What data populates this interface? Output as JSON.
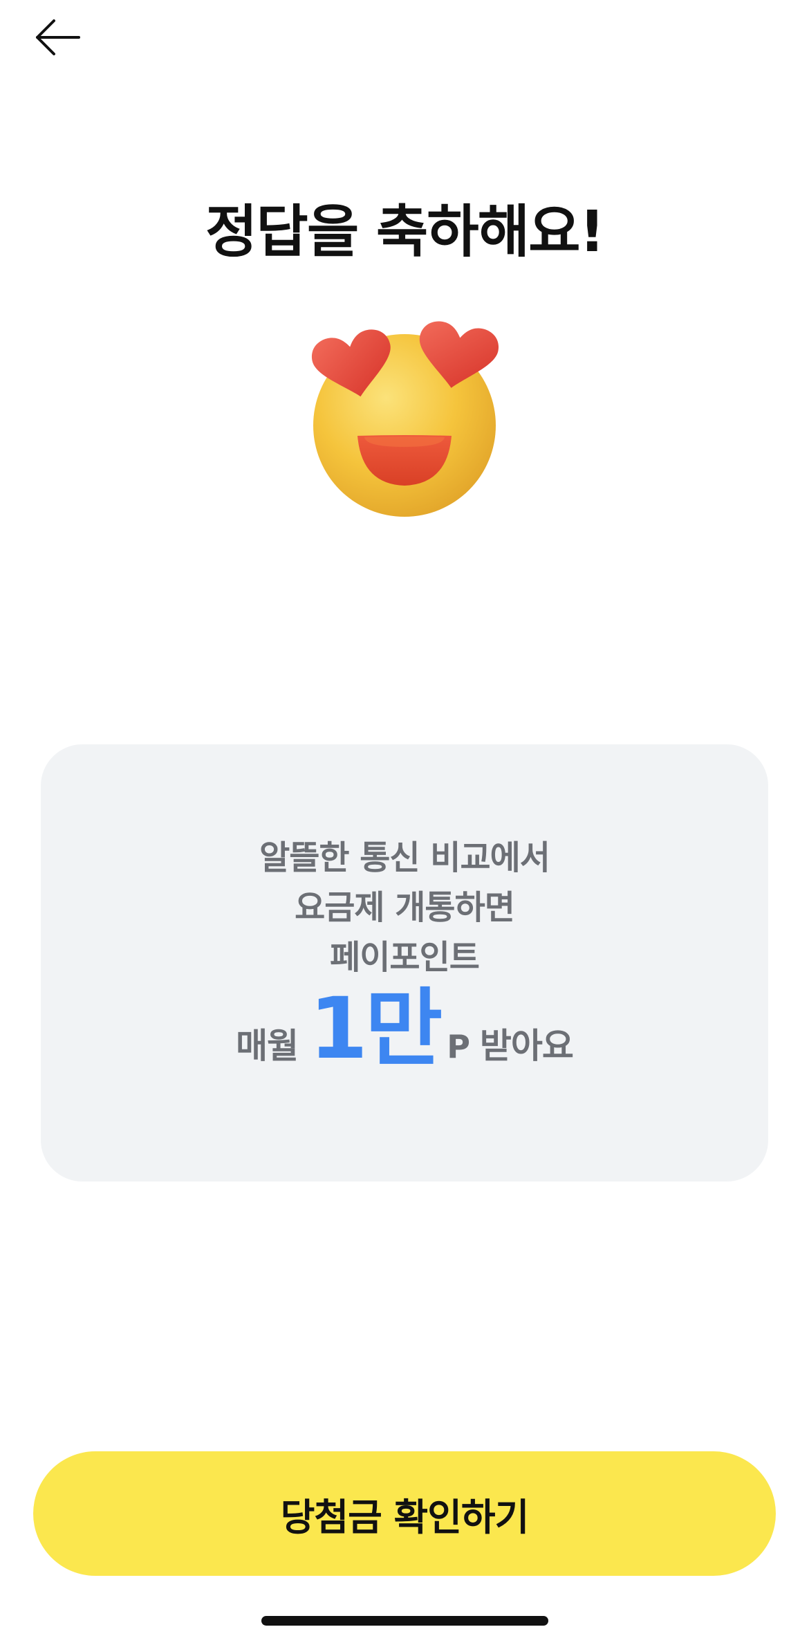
{
  "header": {
    "back_icon": "arrow-left-icon"
  },
  "title": "정답을 축하해요!",
  "emoji": {
    "icon": "heart-eyes-emoji-icon",
    "face_color": "#f5c43c",
    "heart_color": "#e8413a"
  },
  "promo": {
    "line1": "알뜰한 통신 비교에서",
    "line2": "요금제 개통하면",
    "line3": "페이포인트",
    "reward_prefix": "매월",
    "reward_amount": "1만",
    "reward_unit": "P",
    "reward_suffix": "받아요",
    "accent_color": "#3d86f1",
    "background": "#f1f3f5"
  },
  "cta": {
    "label": "당첨금 확인하기",
    "color": "#fbe74e"
  }
}
